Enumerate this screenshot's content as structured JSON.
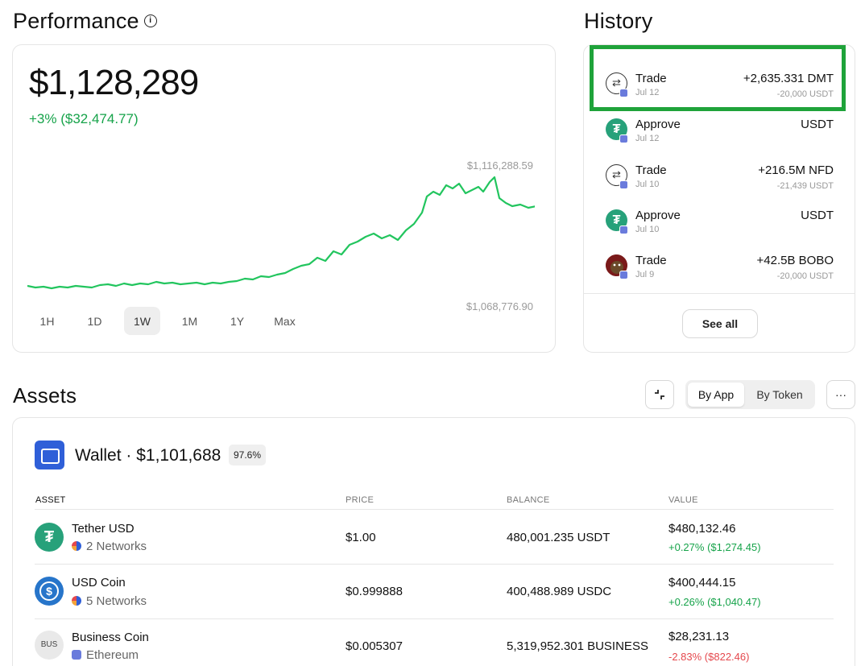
{
  "performance": {
    "title": "Performance",
    "info_icon": "i",
    "value": "$1,128,289",
    "change": "+3% ($32,474.77)",
    "high_label": "$1,116,288.59",
    "low_label": "$1,068,776.90",
    "ranges": [
      "1H",
      "1D",
      "1W",
      "1M",
      "1Y",
      "Max"
    ],
    "active_range": "1W",
    "line_color": "#22c55e"
  },
  "history": {
    "title": "History",
    "items": [
      {
        "type": "Trade",
        "date": "Jul 12",
        "amount": "+2,635.331 DMT",
        "sub": "-20,000 USDT",
        "icon": "swap-icon"
      },
      {
        "type": "Approve",
        "date": "Jul 12",
        "amount": "USDT",
        "sub": "",
        "icon": "tether-icon"
      },
      {
        "type": "Trade",
        "date": "Jul 10",
        "amount": "+216.5M NFD",
        "sub": "-21,439 USDT",
        "icon": "swap-icon"
      },
      {
        "type": "Approve",
        "date": "Jul 10",
        "amount": "USDT",
        "sub": "",
        "icon": "tether-icon"
      },
      {
        "type": "Trade",
        "date": "Jul 9",
        "amount": "+42.5B BOBO",
        "sub": "-20,000 USDT",
        "icon": "bobo-icon"
      }
    ],
    "see_all": "See all",
    "highlight_color": "#1fa33a"
  },
  "assets": {
    "title": "Assets",
    "seg_by_app": "By App",
    "seg_by_token": "By Token",
    "more": "···",
    "collapse_icon": "collapse-icon",
    "wallet_title": "Wallet · $1,101,688",
    "wallet_pct": "97.6%",
    "columns": {
      "asset": "ASSET",
      "price": "PRICE",
      "balance": "BALANCE",
      "value": "VALUE"
    },
    "rows": [
      {
        "name": "Tether USD",
        "networks": "2 Networks",
        "price": "$1.00",
        "balance": "480,001.235 USDT",
        "value": "$480,132.46",
        "change": "+0.27% ($1,274.45)",
        "dir": "pos"
      },
      {
        "name": "USD Coin",
        "networks": "5 Networks",
        "price": "$0.999888",
        "balance": "400,488.989 USDC",
        "value": "$400,444.15",
        "change": "+0.26% ($1,040.47)",
        "dir": "pos"
      },
      {
        "name": "Business Coin",
        "networks": "Ethereum",
        "price": "$0.005307",
        "balance": "5,319,952.301 BUSINESS",
        "value": "$28,231.13",
        "change": "-2.83% ($822.46)",
        "dir": "neg",
        "icon_text": "BUS"
      }
    ]
  }
}
